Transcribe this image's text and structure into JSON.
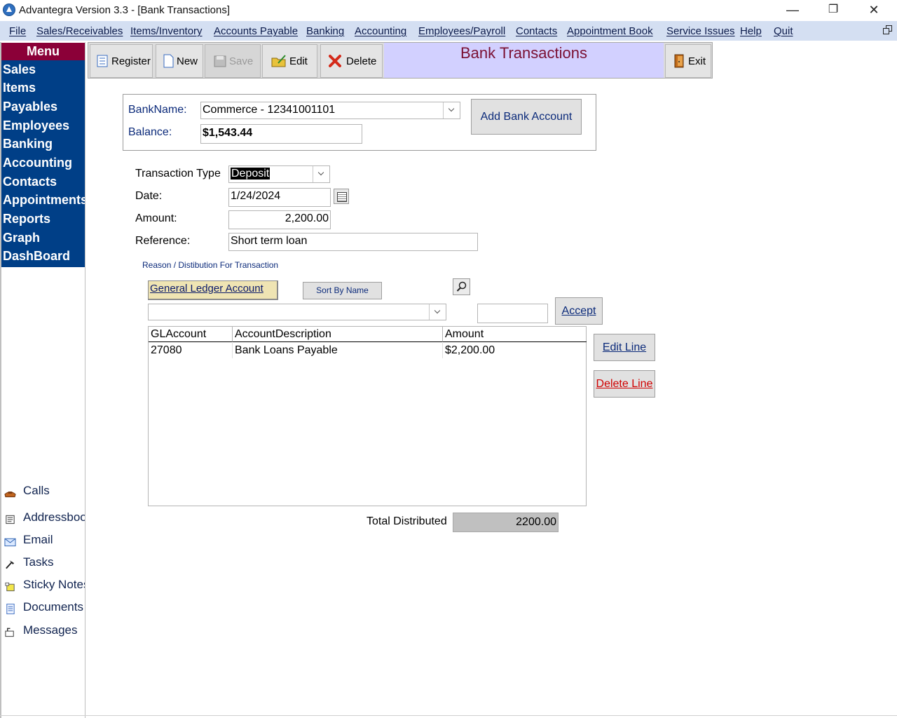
{
  "window": {
    "title": "Advantegra Version 3.3 - [Bank Transactions]",
    "minimize_glyph": "—",
    "maximize_glyph": "❐",
    "close_glyph": "✕"
  },
  "menubar": {
    "items": [
      "File",
      "Sales/Receivables",
      "Items/Inventory",
      "Accounts Payable",
      "Banking",
      "Accounting",
      "Employees/Payroll",
      "Contacts",
      "Appointment Book",
      "Service Issues",
      "Help",
      "Quit"
    ]
  },
  "sidebar": {
    "menu_title": "Menu",
    "nav_items": [
      "Sales",
      "Items",
      "Payables",
      "Employees",
      "Banking",
      "Accounting",
      "Contacts",
      "Appointments",
      "Reports",
      "Graph",
      "DashBoard"
    ],
    "tools": [
      {
        "label": "Calls",
        "icon": "phone-icon"
      },
      {
        "label": "Addressbook",
        "icon": "addressbook-icon"
      },
      {
        "label": "Email",
        "icon": "email-icon"
      },
      {
        "label": "Tasks",
        "icon": "tasks-icon"
      },
      {
        "label": "Sticky Notes",
        "icon": "sticky-note-icon"
      },
      {
        "label": "Documents",
        "icon": "document-icon"
      },
      {
        "label": "Messages",
        "icon": "messages-icon"
      }
    ]
  },
  "toolbar": {
    "register": "Register",
    "new": "New",
    "save": "Save",
    "edit": "Edit",
    "delete": "Delete",
    "title": "Bank Transactions",
    "exit": "Exit"
  },
  "bank": {
    "name_label": "BankName:",
    "name_value": "Commerce - 12341001101",
    "balance_label": "Balance:",
    "balance_value": "$1,543.44",
    "add_button": "Add Bank Account"
  },
  "transaction": {
    "type_label": "Transaction Type",
    "type_value": "Deposit",
    "date_label": "Date:",
    "date_value": "1/24/2024",
    "amount_label": "Amount:",
    "amount_value": "2,200.00",
    "reference_label": "Reference:",
    "reference_value": "Short term loan"
  },
  "distribution": {
    "caption": "Reason / Distibution For Transaction",
    "gl_button": "General Ledger Account",
    "sort_button": "Sort By Name",
    "account_value": "",
    "amount_value": "",
    "accept_button": "Accept",
    "edit_line_button": "Edit Line",
    "delete_line_button": "Delete Line",
    "columns": [
      "GLAccount",
      "AccountDescription",
      "Amount"
    ],
    "rows": [
      {
        "gl": "27080",
        "desc": "Bank Loans Payable",
        "amount": "$2,200.00"
      }
    ],
    "total_label": "Total Distributed",
    "total_value": "2200.00"
  },
  "colors": {
    "nav_bg": "#003f87",
    "menu_head_bg": "#8b0038",
    "menubar_bg": "#d4dff2",
    "title_panel_bg": "#d2d0ff",
    "title_text": "#7a1033",
    "delete_line_text": "#d00000"
  }
}
